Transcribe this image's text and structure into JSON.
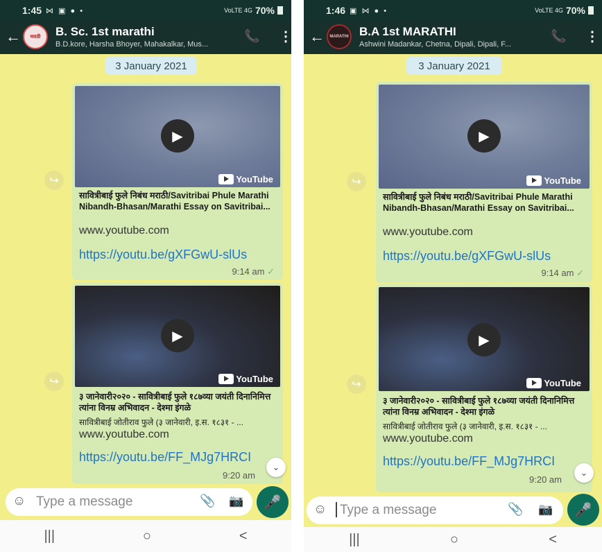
{
  "left": {
    "status": {
      "time": "1:45",
      "icons": "⋈ ▣ ● •",
      "signal": "VoLTE 4G",
      "battery": "70%"
    },
    "chat": {
      "title": "B. Sc. 1st marathi",
      "members": "B.D.kore, Harsha Bhoyer, Mahakalkar, Mus...",
      "avatar_label": "मराठी"
    },
    "date_chip": "3 January 2021",
    "messages": [
      {
        "title": "सावित्रीबाई फुले निबंध मराठी/Savitribai Phule Marathi Nibandh-Bhasan/Marathi Essay on Savitribai...",
        "description": "",
        "domain": "www.youtube.com",
        "url": "https://youtu.be/gXFGwU-slUs",
        "time": "9:14 am",
        "tick": "✓",
        "yt_label": "YouTube"
      },
      {
        "title": "३ जानेवारी२०२० - सावित्रीबाई फुले १८७व्या जयंती दिनानिमित्त त्यांना विनम्र अभिवादन - देश्मा इंगळे",
        "description": "सावित्रीबाई जोतीराव फुले (३ जानेवारी, इ.स. १८३१ - ...",
        "domain": "www.youtube.com",
        "url": "https://youtu.be/FF_MJg7HRCI",
        "time": "9:20 am",
        "tick": "",
        "yt_label": "YouTube"
      }
    ],
    "input": {
      "placeholder": "Type a message"
    }
  },
  "right": {
    "status": {
      "time": "1:46",
      "icons": "▣ ⋈ ● •",
      "signal": "VoLTE 4G",
      "battery": "70%"
    },
    "chat": {
      "title": "B.A 1st MARATHI",
      "members": "Ashwini Madankar, Chetna, Dipali, Dipali, F...",
      "avatar_label": "MARATHI"
    },
    "date_chip": "3 January 2021",
    "messages": [
      {
        "title": "सावित्रीबाई फुले निबंध मराठी/Savitribai Phule Marathi Nibandh-Bhasan/Marathi Essay on Savitribai...",
        "description": "",
        "domain": "www.youtube.com",
        "url": "https://youtu.be/gXFGwU-slUs",
        "time": "9:14 am",
        "tick": "✓",
        "yt_label": "YouTube"
      },
      {
        "title": "३ जानेवारी२०२० - सावित्रीबाई फुले १८७व्या जयंती दिनानिमित्त त्यांना विनम्र अभिवादन - देश्मा इंगळे",
        "description": "सावित्रीबाई जोतीराव फुले (३ जानेवारी, इ.स. १८३१ - ...",
        "domain": "www.youtube.com",
        "url": "https://youtu.be/FF_MJg7HRCI",
        "time": "9:20 am",
        "tick": "",
        "yt_label": "YouTube"
      }
    ],
    "input": {
      "placeholder": "Type a message"
    }
  },
  "icons": {
    "back": "←",
    "call": "📞",
    "menu": "⋮",
    "play": "▶",
    "forward": "↪",
    "scroll": "⌄",
    "emoji": "☺",
    "attach": "📎",
    "camera": "📷",
    "mic": "🎤",
    "nav_recent": "|||",
    "nav_home": "○",
    "nav_back": "<"
  },
  "colors": {
    "header": "#17302c",
    "chat_bg": "#f2ef8a",
    "bubble": "#d6ebb4",
    "link": "#1f73c7",
    "mic": "#0d6e5a"
  }
}
